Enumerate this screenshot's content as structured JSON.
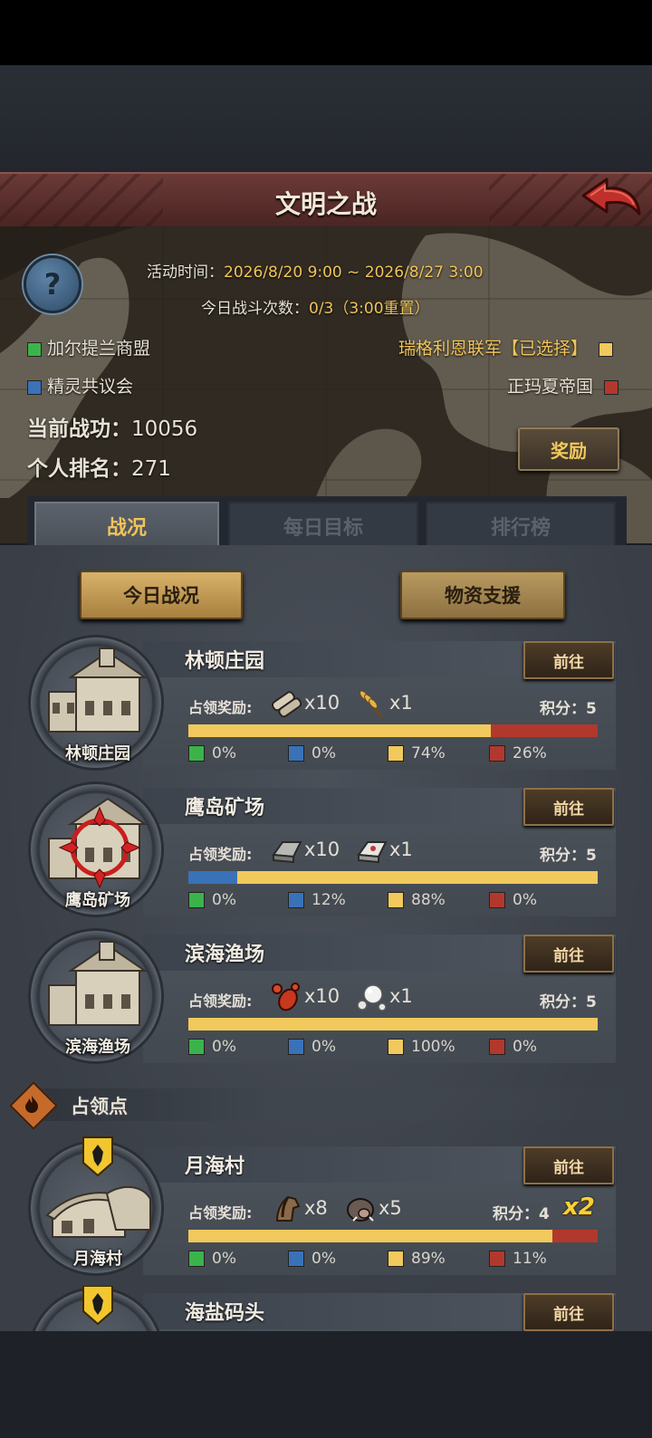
{
  "header": {
    "title": "文明之战"
  },
  "event": {
    "time_label": "活动时间：",
    "time_value": "2026/8/20 9:00 ~ 2026/8/27 3:00",
    "battles_label": "今日战斗次数：",
    "battles_value": "0/3（3:00重置）"
  },
  "factions": {
    "green": {
      "name": "加尔提兰商盟",
      "color": "#3bb34a"
    },
    "blue": {
      "name": "精灵共议会",
      "color": "#3a72b8"
    },
    "yellow": {
      "name": "瑞格利恩联军【已选择】",
      "color": "#f1c95c"
    },
    "red": {
      "name": "正玛夏帝国",
      "color": "#b2382e"
    }
  },
  "player": {
    "merit_label": "当前战功：",
    "merit_value": "10056",
    "rank_label": "个人排名：",
    "rank_value": "271"
  },
  "reward_button": "奖励",
  "tabs": [
    "战况",
    "每日目标",
    "排行榜"
  ],
  "sub_buttons": {
    "today": "今日战况",
    "supply": "物资支援"
  },
  "section_title": "占领点",
  "labels": {
    "reward": "占领奖励:",
    "go": "前往",
    "score_prefix": "积分："
  },
  "cards": [
    {
      "name": "林顿庄园",
      "badge": "林顿庄园",
      "rewards": [
        {
          "icon": "scroll-icon",
          "qty": "x10"
        },
        {
          "icon": "wheat-icon",
          "qty": "x1"
        }
      ],
      "score": "5",
      "bonus": "",
      "shares": [
        0,
        0,
        74,
        26
      ],
      "share_text": [
        "0%",
        "0%",
        "74%",
        "26%"
      ]
    },
    {
      "name": "鹰岛矿场",
      "badge": "鹰岛矿场",
      "rewards": [
        {
          "icon": "iron-ingot-icon",
          "qty": "x10"
        },
        {
          "icon": "silver-ingot-icon",
          "qty": "x1"
        }
      ],
      "score": "5",
      "bonus": "",
      "shares": [
        0,
        12,
        88,
        0
      ],
      "share_text": [
        "0%",
        "12%",
        "88%",
        "0%"
      ]
    },
    {
      "name": "滨海渔场",
      "badge": "滨海渔场",
      "rewards": [
        {
          "icon": "lobster-icon",
          "qty": "x10"
        },
        {
          "icon": "pearl-icon",
          "qty": "x1"
        }
      ],
      "score": "5",
      "bonus": "",
      "shares": [
        0,
        0,
        100,
        0
      ],
      "share_text": [
        "0%",
        "0%",
        "100%",
        "0%"
      ]
    },
    {
      "name": "月海村",
      "badge": "月海村",
      "rewards": [
        {
          "icon": "horse-icon",
          "qty": "x8"
        },
        {
          "icon": "boar-icon",
          "qty": "x5"
        }
      ],
      "score": "4",
      "bonus": "x2",
      "shares": [
        0,
        0,
        89,
        11
      ],
      "share_text": [
        "0%",
        "0%",
        "89%",
        "11%"
      ]
    },
    {
      "name": "海盐码头",
      "badge": "",
      "rewards": [],
      "score": "",
      "bonus": "",
      "shares": [],
      "share_text": []
    }
  ]
}
